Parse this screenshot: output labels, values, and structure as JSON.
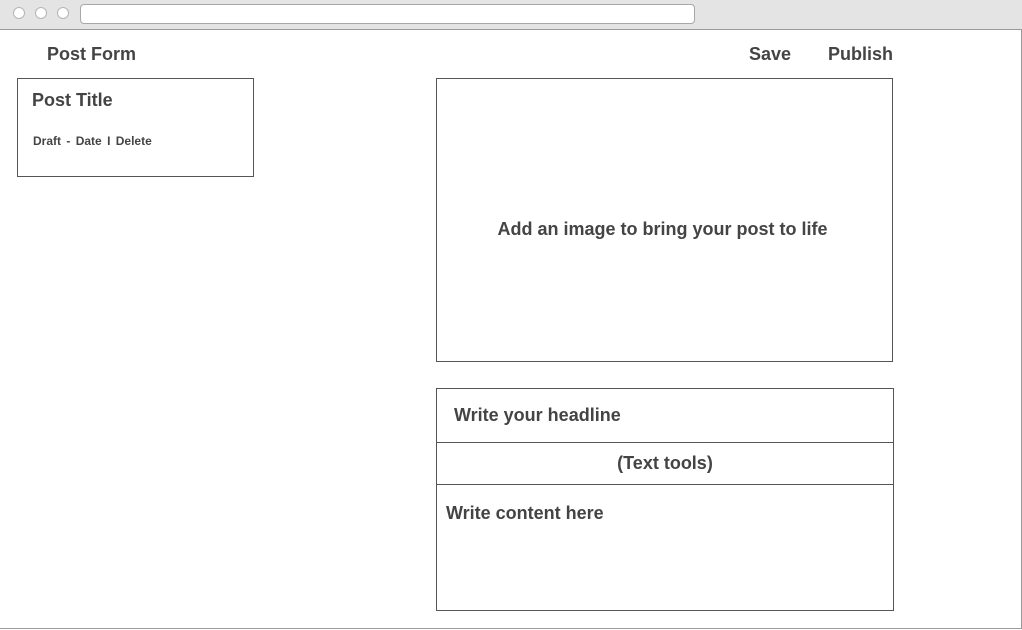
{
  "header": {
    "title": "Post Form",
    "save_label": "Save",
    "publish_label": "Publish"
  },
  "post_card": {
    "title": "Post Title",
    "status": "Draft",
    "status_separator": "-",
    "date": "Date",
    "action_separator": "I",
    "delete_label": "Delete"
  },
  "image_upload": {
    "prompt": "Add an image to bring your post to life"
  },
  "editor": {
    "headline_placeholder": "Write your headline",
    "toolbar_label": "(Text tools)",
    "content_placeholder": "Write content here"
  }
}
